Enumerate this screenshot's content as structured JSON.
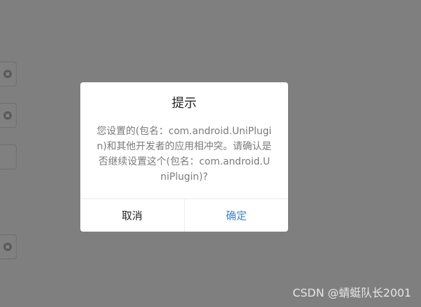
{
  "dialog": {
    "title": "提示",
    "message": "您设置的(包名：com.android.UniPlugin)和其他开发者的应用相冲突。请确认是否继续设置这个(包名：com.android.UniPlugin)?",
    "cancel_label": "取消",
    "confirm_label": "确定"
  },
  "watermark": {
    "text": "CSDN @蜻蜓队长2001"
  },
  "colors": {
    "overlay": "#7f7f7f",
    "confirm_text": "#2f86e0",
    "message_text": "#7a7a7a"
  },
  "icons": {
    "clear": "clear-circle-x-icon"
  }
}
